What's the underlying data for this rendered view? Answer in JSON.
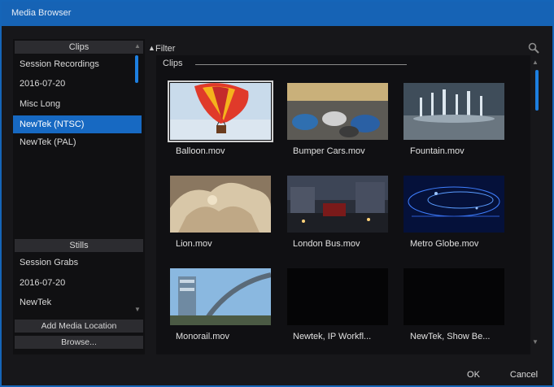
{
  "window": {
    "title": "Media Browser"
  },
  "left": {
    "clips_header": "Clips",
    "clip_locations": [
      "Session Recordings",
      "2016-07-20",
      "Misc Long",
      "NewTek (NTSC)",
      "NewTek (PAL)"
    ],
    "selected_location": "NewTek (NTSC)",
    "stills_header": "Stills",
    "still_locations": [
      "Session Grabs",
      "2016-07-20",
      "NewTek"
    ],
    "add_media_location": "Add Media Location",
    "browse": "Browse..."
  },
  "filter": {
    "label": "Filter",
    "icon": "search-icon"
  },
  "content": {
    "group_title": "Clips",
    "items": [
      {
        "label": "Balloon.mov",
        "thumb": "balloon",
        "selected": true
      },
      {
        "label": "Bumper Cars.mov",
        "thumb": "bumper-cars"
      },
      {
        "label": "Fountain.mov",
        "thumb": "fountain"
      },
      {
        "label": "Lion.mov",
        "thumb": "lion"
      },
      {
        "label": "London Bus.mov",
        "thumb": "london-bus"
      },
      {
        "label": "Metro Globe.mov",
        "thumb": "metro-globe"
      },
      {
        "label": "Monorail.mov",
        "thumb": "monorail"
      },
      {
        "label": "Newtek, IP Workfl...",
        "thumb": "black"
      },
      {
        "label": "NewTek, Show Be...",
        "thumb": "black"
      }
    ]
  },
  "footer": {
    "ok": "OK",
    "cancel": "Cancel"
  },
  "colors": {
    "accent": "#1769c2",
    "scrollbar": "#1d7fe0",
    "background": "#17171a"
  }
}
